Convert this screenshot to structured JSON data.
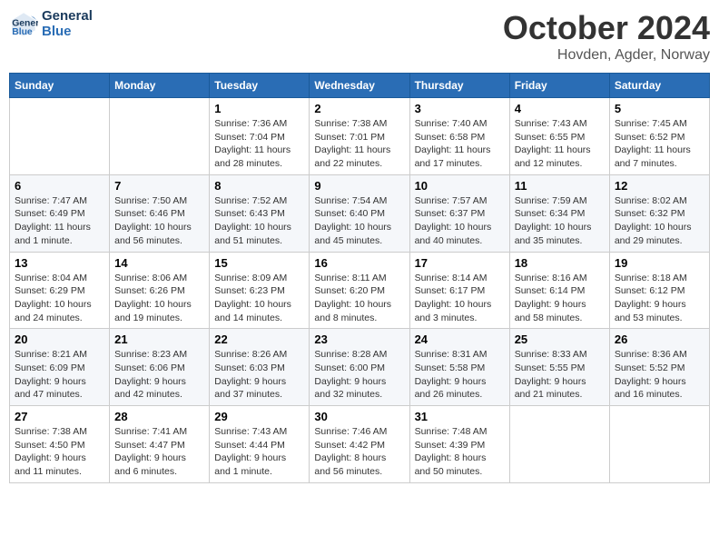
{
  "header": {
    "logo_line1": "General",
    "logo_line2": "Blue",
    "month": "October 2024",
    "location": "Hovden, Agder, Norway"
  },
  "days_of_week": [
    "Sunday",
    "Monday",
    "Tuesday",
    "Wednesday",
    "Thursday",
    "Friday",
    "Saturday"
  ],
  "weeks": [
    [
      {
        "day": "",
        "sunrise": "",
        "sunset": "",
        "daylight": ""
      },
      {
        "day": "",
        "sunrise": "",
        "sunset": "",
        "daylight": ""
      },
      {
        "day": "1",
        "sunrise": "Sunrise: 7:36 AM",
        "sunset": "Sunset: 7:04 PM",
        "daylight": "Daylight: 11 hours and 28 minutes."
      },
      {
        "day": "2",
        "sunrise": "Sunrise: 7:38 AM",
        "sunset": "Sunset: 7:01 PM",
        "daylight": "Daylight: 11 hours and 22 minutes."
      },
      {
        "day": "3",
        "sunrise": "Sunrise: 7:40 AM",
        "sunset": "Sunset: 6:58 PM",
        "daylight": "Daylight: 11 hours and 17 minutes."
      },
      {
        "day": "4",
        "sunrise": "Sunrise: 7:43 AM",
        "sunset": "Sunset: 6:55 PM",
        "daylight": "Daylight: 11 hours and 12 minutes."
      },
      {
        "day": "5",
        "sunrise": "Sunrise: 7:45 AM",
        "sunset": "Sunset: 6:52 PM",
        "daylight": "Daylight: 11 hours and 7 minutes."
      }
    ],
    [
      {
        "day": "6",
        "sunrise": "Sunrise: 7:47 AM",
        "sunset": "Sunset: 6:49 PM",
        "daylight": "Daylight: 11 hours and 1 minute."
      },
      {
        "day": "7",
        "sunrise": "Sunrise: 7:50 AM",
        "sunset": "Sunset: 6:46 PM",
        "daylight": "Daylight: 10 hours and 56 minutes."
      },
      {
        "day": "8",
        "sunrise": "Sunrise: 7:52 AM",
        "sunset": "Sunset: 6:43 PM",
        "daylight": "Daylight: 10 hours and 51 minutes."
      },
      {
        "day": "9",
        "sunrise": "Sunrise: 7:54 AM",
        "sunset": "Sunset: 6:40 PM",
        "daylight": "Daylight: 10 hours and 45 minutes."
      },
      {
        "day": "10",
        "sunrise": "Sunrise: 7:57 AM",
        "sunset": "Sunset: 6:37 PM",
        "daylight": "Daylight: 10 hours and 40 minutes."
      },
      {
        "day": "11",
        "sunrise": "Sunrise: 7:59 AM",
        "sunset": "Sunset: 6:34 PM",
        "daylight": "Daylight: 10 hours and 35 minutes."
      },
      {
        "day": "12",
        "sunrise": "Sunrise: 8:02 AM",
        "sunset": "Sunset: 6:32 PM",
        "daylight": "Daylight: 10 hours and 29 minutes."
      }
    ],
    [
      {
        "day": "13",
        "sunrise": "Sunrise: 8:04 AM",
        "sunset": "Sunset: 6:29 PM",
        "daylight": "Daylight: 10 hours and 24 minutes."
      },
      {
        "day": "14",
        "sunrise": "Sunrise: 8:06 AM",
        "sunset": "Sunset: 6:26 PM",
        "daylight": "Daylight: 10 hours and 19 minutes."
      },
      {
        "day": "15",
        "sunrise": "Sunrise: 8:09 AM",
        "sunset": "Sunset: 6:23 PM",
        "daylight": "Daylight: 10 hours and 14 minutes."
      },
      {
        "day": "16",
        "sunrise": "Sunrise: 8:11 AM",
        "sunset": "Sunset: 6:20 PM",
        "daylight": "Daylight: 10 hours and 8 minutes."
      },
      {
        "day": "17",
        "sunrise": "Sunrise: 8:14 AM",
        "sunset": "Sunset: 6:17 PM",
        "daylight": "Daylight: 10 hours and 3 minutes."
      },
      {
        "day": "18",
        "sunrise": "Sunrise: 8:16 AM",
        "sunset": "Sunset: 6:14 PM",
        "daylight": "Daylight: 9 hours and 58 minutes."
      },
      {
        "day": "19",
        "sunrise": "Sunrise: 8:18 AM",
        "sunset": "Sunset: 6:12 PM",
        "daylight": "Daylight: 9 hours and 53 minutes."
      }
    ],
    [
      {
        "day": "20",
        "sunrise": "Sunrise: 8:21 AM",
        "sunset": "Sunset: 6:09 PM",
        "daylight": "Daylight: 9 hours and 47 minutes."
      },
      {
        "day": "21",
        "sunrise": "Sunrise: 8:23 AM",
        "sunset": "Sunset: 6:06 PM",
        "daylight": "Daylight: 9 hours and 42 minutes."
      },
      {
        "day": "22",
        "sunrise": "Sunrise: 8:26 AM",
        "sunset": "Sunset: 6:03 PM",
        "daylight": "Daylight: 9 hours and 37 minutes."
      },
      {
        "day": "23",
        "sunrise": "Sunrise: 8:28 AM",
        "sunset": "Sunset: 6:00 PM",
        "daylight": "Daylight: 9 hours and 32 minutes."
      },
      {
        "day": "24",
        "sunrise": "Sunrise: 8:31 AM",
        "sunset": "Sunset: 5:58 PM",
        "daylight": "Daylight: 9 hours and 26 minutes."
      },
      {
        "day": "25",
        "sunrise": "Sunrise: 8:33 AM",
        "sunset": "Sunset: 5:55 PM",
        "daylight": "Daylight: 9 hours and 21 minutes."
      },
      {
        "day": "26",
        "sunrise": "Sunrise: 8:36 AM",
        "sunset": "Sunset: 5:52 PM",
        "daylight": "Daylight: 9 hours and 16 minutes."
      }
    ],
    [
      {
        "day": "27",
        "sunrise": "Sunrise: 7:38 AM",
        "sunset": "Sunset: 4:50 PM",
        "daylight": "Daylight: 9 hours and 11 minutes."
      },
      {
        "day": "28",
        "sunrise": "Sunrise: 7:41 AM",
        "sunset": "Sunset: 4:47 PM",
        "daylight": "Daylight: 9 hours and 6 minutes."
      },
      {
        "day": "29",
        "sunrise": "Sunrise: 7:43 AM",
        "sunset": "Sunset: 4:44 PM",
        "daylight": "Daylight: 9 hours and 1 minute."
      },
      {
        "day": "30",
        "sunrise": "Sunrise: 7:46 AM",
        "sunset": "Sunset: 4:42 PM",
        "daylight": "Daylight: 8 hours and 56 minutes."
      },
      {
        "day": "31",
        "sunrise": "Sunrise: 7:48 AM",
        "sunset": "Sunset: 4:39 PM",
        "daylight": "Daylight: 8 hours and 50 minutes."
      },
      {
        "day": "",
        "sunrise": "",
        "sunset": "",
        "daylight": ""
      },
      {
        "day": "",
        "sunrise": "",
        "sunset": "",
        "daylight": ""
      }
    ]
  ]
}
